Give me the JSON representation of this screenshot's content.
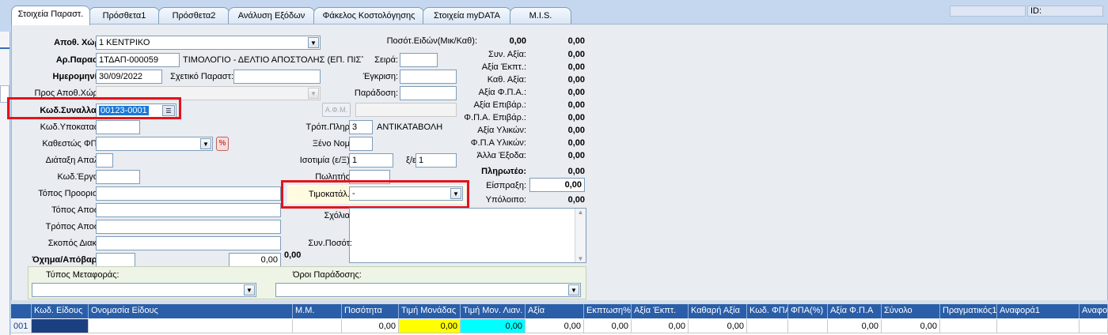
{
  "tabs": [
    "Στοιχεία Παραστ.",
    "Πρόσθετα1",
    "Πρόσθετα2",
    "Ανάλυση Εξόδων",
    "Φάκελος Κοστολόγησης",
    "Στοιχεία myDATA",
    "M.I.S."
  ],
  "topbar": {
    "id_label": "ID:"
  },
  "form": {
    "apoth_label": "Αποθ. Χώρ.:",
    "apoth_value": "1 ΚΕΝΤΡΙΚΟ",
    "arparast_label": "Αρ.Παραστ:",
    "arparast_value": "1ΤΔΑΠ-000059",
    "arparast_desc": "ΤΙΜΟΛΟΓΙΟ - ΔΕΛΤΙΟ ΑΠΟΣΤΟΛΗΣ (ΕΠ. ΠΙΣΤ",
    "date_label": "Ημερομηνία:",
    "date_value": "30/09/2022",
    "sxetiko_label": "Σχετικό Παραστ:",
    "pros_label": "Προς Αποθ.Χώρο:",
    "kod_label": "Κωδ.Συναλλασ:",
    "kod_value": "00123-0001",
    "afm_label": "Α.Φ.Μ.",
    "kod_ypok_label": "Κωδ.Υποκαταστ:",
    "kathestos_label": "Καθεστώς ΦΠΑ:",
    "diataxi_label": "Διάταξη Απαλλ:",
    "ergou_label": "Κωδ.Έργου:",
    "topos_pro_label": "Τόπος Προορισμ:",
    "topos_apo_label": "Τόπος Αποστ:",
    "tropos_label": "Τρόπος Αποστ:",
    "skopos_label": "Σκοπός Διακίν:",
    "oxima_label": "Όχημα/Απόβαρο:",
    "oxima_value": "0,00",
    "posot_label": "Ποσότ.Ειδών(Μικ/Καθ):",
    "posot_v1": "0,00",
    "posot_v2": "0,00",
    "seira_label": "Σειρά:",
    "egkrisi_label": "Έγκριση:",
    "paradosi_label": "Παράδοση:",
    "tropos_plir_label": "Τρόπ.Πληρ:",
    "tropos_plir_code": "3",
    "tropos_plir_text": "ΑΝΤΙΚΑΤΑΒΟΛΗ",
    "xeno_label": "Ξένο Νομ:",
    "isotimia_label": "Ισοτιμία (ε/Ξ):",
    "isotimia_value": "1",
    "xe_label": "ξ/ε:",
    "xe_value": "1",
    "politis_label": "Πωλητής:",
    "timokat_label": "Τιμοκατάλ.:",
    "timokat_value": "-",
    "sxolia_label": "Σχόλια:",
    "synposot_label": "Συν.Ποσότ:",
    "synposot_value": "0,00",
    "metafora_label": "Τύπος Μεταφοράς:",
    "oroi_label": "Όροι Παράδοσης:"
  },
  "totals": [
    {
      "label": "Συν. Αξία:",
      "value": "0,00",
      "bold": false
    },
    {
      "label": "Αξία Έκπτ.:",
      "value": "0,00",
      "bold": false
    },
    {
      "label": "Καθ. Αξία:",
      "value": "0,00",
      "bold": false
    },
    {
      "label": "Αξία Φ.Π.Α.:",
      "value": "0,00",
      "bold": false
    },
    {
      "label": "Αξία Επιβάρ.:",
      "value": "0,00",
      "bold": false
    },
    {
      "label": "Φ.Π.Α. Επιβάρ.:",
      "value": "0,00",
      "bold": false
    },
    {
      "label": "Αξία Υλικών:",
      "value": "0,00",
      "bold": false
    },
    {
      "label": "Φ.Π.Α Υλικών:",
      "value": "0,00",
      "bold": false
    },
    {
      "label": "Άλλα Έξοδα:",
      "value": "0,00",
      "bold": false
    },
    {
      "label": "Πληρωτέο:",
      "value": "0,00",
      "bold": true
    }
  ],
  "eispraxi_label": "Είσπραξη:",
  "eispraxi_value": "0,00",
  "ypoloipo_label": "Υπόλοιπο:",
  "ypoloipo_value": "0,00",
  "grid": {
    "headers": [
      "",
      "Κωδ. Είδους",
      "Ονομασία Είδους",
      "Μ.Μ.",
      "Ποσότητα",
      "Τιμή Μονάδας",
      "Τιμή Μον. Λιαν.",
      "Αξία",
      "Εκπτωση%",
      "Αξία Έκπτ.",
      "Καθαρή Αξία",
      "Κωδ. ΦΠΑ",
      "ΦΠΑ(%)",
      "Αξία Φ.Π.Α",
      "Σύνολο",
      "Πραγματικός1",
      "Αναφορά1",
      "Αναφο"
    ],
    "row": [
      "001",
      "",
      "",
      "",
      "0,00",
      "0,00",
      "0,00",
      "0,00",
      "0,00",
      "0,00",
      "0,00",
      "",
      "",
      "0,00",
      "0,00",
      "",
      "",
      ""
    ]
  },
  "colors": {
    "highlight_yellow": "#ffff00",
    "highlight_cyan": "#00ffff",
    "header_blue": "#2a5ea8",
    "annotation_red": "#e3141b"
  }
}
